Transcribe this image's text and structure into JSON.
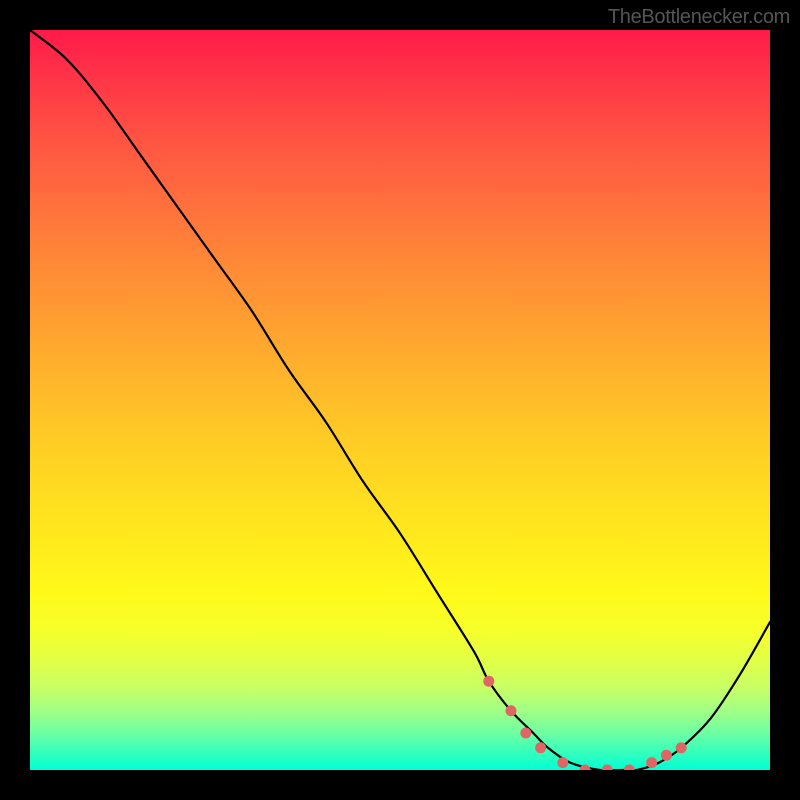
{
  "attribution": "TheBottlenecker.com",
  "chart_data": {
    "type": "line",
    "title": "",
    "xlabel": "",
    "ylabel": "",
    "xlim": [
      0,
      100
    ],
    "ylim": [
      0,
      100
    ],
    "series": [
      {
        "name": "bottleneck-curve",
        "x": [
          0,
          5,
          10,
          15,
          20,
          25,
          30,
          35,
          40,
          45,
          50,
          55,
          60,
          62,
          65,
          68,
          70,
          73,
          77,
          80,
          82,
          85,
          88,
          92,
          96,
          100
        ],
        "y": [
          100,
          96,
          90,
          83,
          76,
          69,
          62,
          54,
          47,
          39,
          32,
          24,
          16,
          12,
          8,
          5,
          3,
          1,
          0,
          0,
          0,
          1,
          3,
          7,
          13,
          20
        ]
      }
    ],
    "markers": {
      "name": "highlight-dots",
      "points": [
        {
          "x": 62,
          "y": 12
        },
        {
          "x": 65,
          "y": 8
        },
        {
          "x": 67,
          "y": 5
        },
        {
          "x": 69,
          "y": 3
        },
        {
          "x": 72,
          "y": 1
        },
        {
          "x": 75,
          "y": 0
        },
        {
          "x": 78,
          "y": 0
        },
        {
          "x": 81,
          "y": 0
        },
        {
          "x": 84,
          "y": 1
        },
        {
          "x": 86,
          "y": 2
        },
        {
          "x": 88,
          "y": 3
        }
      ]
    },
    "gradient_stops": [
      {
        "pos": 0,
        "color": "#ff1a4a"
      },
      {
        "pos": 100,
        "color": "#00ffd4"
      }
    ]
  }
}
